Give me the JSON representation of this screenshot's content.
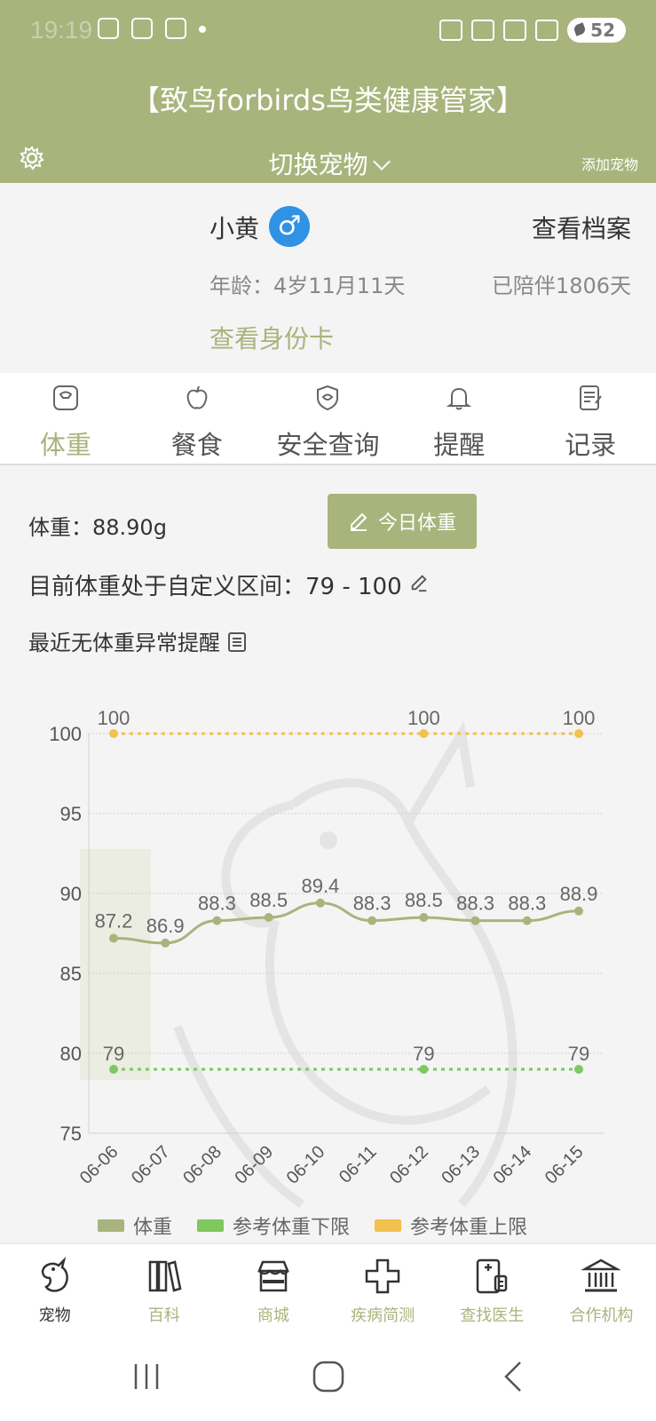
{
  "status": {
    "time": "19:19",
    "battery": "52"
  },
  "header": {
    "title": "【致鸟forbirds鸟类健康管家】",
    "switch_pet": "切换宠物",
    "add_pet": "添加宠物"
  },
  "pet": {
    "name": "小黄",
    "gender_symbol": "♂",
    "view_profile": "查看档案",
    "age": "年龄：4岁11月11天",
    "accompany": "已陪伴1806天",
    "view_id_card": "查看身份卡"
  },
  "tabs": [
    {
      "label": "体重",
      "icon": "scale-icon"
    },
    {
      "label": "餐食",
      "icon": "apple-icon"
    },
    {
      "label": "安全查询",
      "icon": "shield-leaf-icon"
    },
    {
      "label": "提醒",
      "icon": "bell-icon"
    },
    {
      "label": "记录",
      "icon": "notepad-icon"
    }
  ],
  "weight": {
    "current": "体重：88.90g",
    "today_button": "今日体重",
    "range_text": "目前体重处于自定义区间：79 - 100",
    "no_alert": "最近无体重异常提醒"
  },
  "colors": {
    "brand": "#a8b47c",
    "weight_line": "#a8b47c",
    "lower_line": "#7dc85f",
    "upper_line": "#f2c14e"
  },
  "chart_data": {
    "type": "line",
    "categories": [
      "06-06",
      "06-07",
      "06-08",
      "06-09",
      "06-10",
      "06-11",
      "06-12",
      "06-13",
      "06-14",
      "06-15"
    ],
    "series": [
      {
        "name": "体重",
        "values": [
          87.2,
          86.9,
          88.3,
          88.5,
          89.4,
          88.3,
          88.5,
          88.3,
          88.3,
          88.9
        ],
        "labels": [
          "87.2",
          "86.9",
          "88.3",
          "88.5",
          "89.4",
          "88.3",
          "88.5",
          "88.3",
          "88.3",
          "88.9"
        ]
      },
      {
        "name": "参考体重下限",
        "values": [
          79,
          79,
          79,
          79,
          79,
          79,
          79,
          79,
          79,
          79
        ],
        "labels": [
          "79",
          "79",
          "79"
        ],
        "label_indices": [
          0,
          6,
          9
        ]
      },
      {
        "name": "参考体重上限",
        "values": [
          100,
          100,
          100,
          100,
          100,
          100,
          100,
          100,
          100,
          100
        ],
        "labels": [
          "100",
          "100",
          "100"
        ],
        "label_indices": [
          0,
          6,
          9
        ]
      }
    ],
    "yticks": [
      "75",
      "80",
      "85",
      "90",
      "95",
      "100"
    ],
    "ylim": [
      75,
      100
    ],
    "grid": true,
    "legend": "bottom"
  },
  "bottom_nav": [
    {
      "label": "宠物",
      "icon": "parrot-icon"
    },
    {
      "label": "百科",
      "icon": "books-icon"
    },
    {
      "label": "商城",
      "icon": "store-icon"
    },
    {
      "label": "疾病简测",
      "icon": "cross-icon"
    },
    {
      "label": "查找医生",
      "icon": "doctor-icon"
    },
    {
      "label": "合作机构",
      "icon": "institution-icon"
    }
  ]
}
